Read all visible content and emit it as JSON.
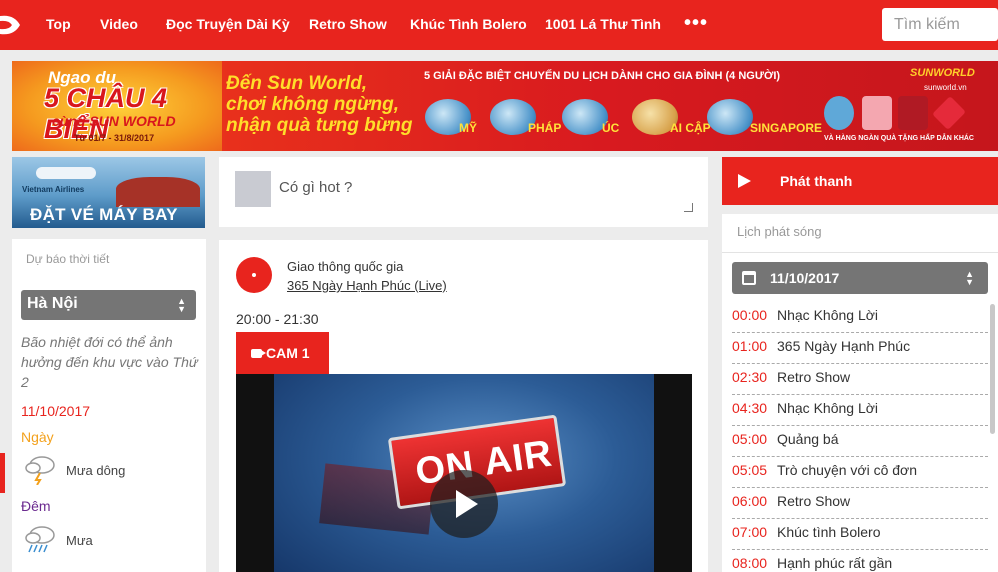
{
  "nav": {
    "items": [
      "Top",
      "Video",
      "Đọc Truyện Dài Kỳ",
      "Retro Show",
      "Khúc Tình Bolero",
      "1001 Lá Thư Tình"
    ],
    "more": "•••",
    "search_placeholder": "Tìm kiếm"
  },
  "banner": {
    "line1": "Ngao du",
    "line2": "5 CHÂU 4 BIỂN",
    "line3": "cùng SUN WORLD",
    "dates": "Từ 01/7 - 31/8/2017",
    "headline1": "Đến Sun World,",
    "headline2": "chơi không ngừng,",
    "headline3": "nhận quà tưng bừng",
    "prize_text": "5 GIẢI ĐẶC BIỆT CHUYẾN DU LỊCH DÀNH CHO GIA ĐÌNH (4 NGƯỜI)",
    "destinations": [
      "MỸ",
      "PHÁP",
      "ÚC",
      "AI CẬP",
      "SINGAPORE"
    ],
    "brand": "SUNWORLD",
    "website": "sunworld.vn",
    "gift_text": "VÀ HÀNG NGÀN QUÀ TẶNG HẤP DẪN KHÁC"
  },
  "flight_ad": {
    "airline": "Vietnam Airlines",
    "text": "ĐẶT VÉ MÁY BAY"
  },
  "weather": {
    "title": "Dự báo thời tiết",
    "city": "Hà Nội",
    "description": "Bão nhiệt đới có thể ảnh hưởng đến khu vực vào Thứ 2",
    "date": "11/10/2017",
    "day_label": "Ngày",
    "day_condition": "Mưa dông",
    "night_label": "Đêm",
    "night_condition": "Mưa"
  },
  "post": {
    "placeholder": "Có gì hot ?"
  },
  "live": {
    "channel": "Giao thông quốc gia",
    "program": "365 Ngày Hạnh Phúc (Live)",
    "time": "20:00 - 21:30",
    "cam_label": "CAM 1",
    "video_sign": "ON AIR"
  },
  "radio": {
    "label": "Phát thanh",
    "schedule_title": "Lịch phát sóng",
    "date": "11/10/2017",
    "schedule": [
      {
        "time": "00:00",
        "program": "Nhạc Không Lời"
      },
      {
        "time": "01:00",
        "program": "365 Ngày Hạnh Phúc"
      },
      {
        "time": "02:30",
        "program": "Retro Show"
      },
      {
        "time": "04:30",
        "program": "Nhạc Không Lời"
      },
      {
        "time": "05:00",
        "program": "Quảng bá"
      },
      {
        "time": "05:05",
        "program": "Trò chuyện với cô đơn"
      },
      {
        "time": "06:00",
        "program": "Retro Show"
      },
      {
        "time": "07:00",
        "program": "Khúc tình Bolero"
      },
      {
        "time": "08:00",
        "program": "Hạnh phúc rất gần"
      }
    ]
  },
  "colors": {
    "brand_red": "#e8241e",
    "banner_yellow": "#ffde2a"
  }
}
